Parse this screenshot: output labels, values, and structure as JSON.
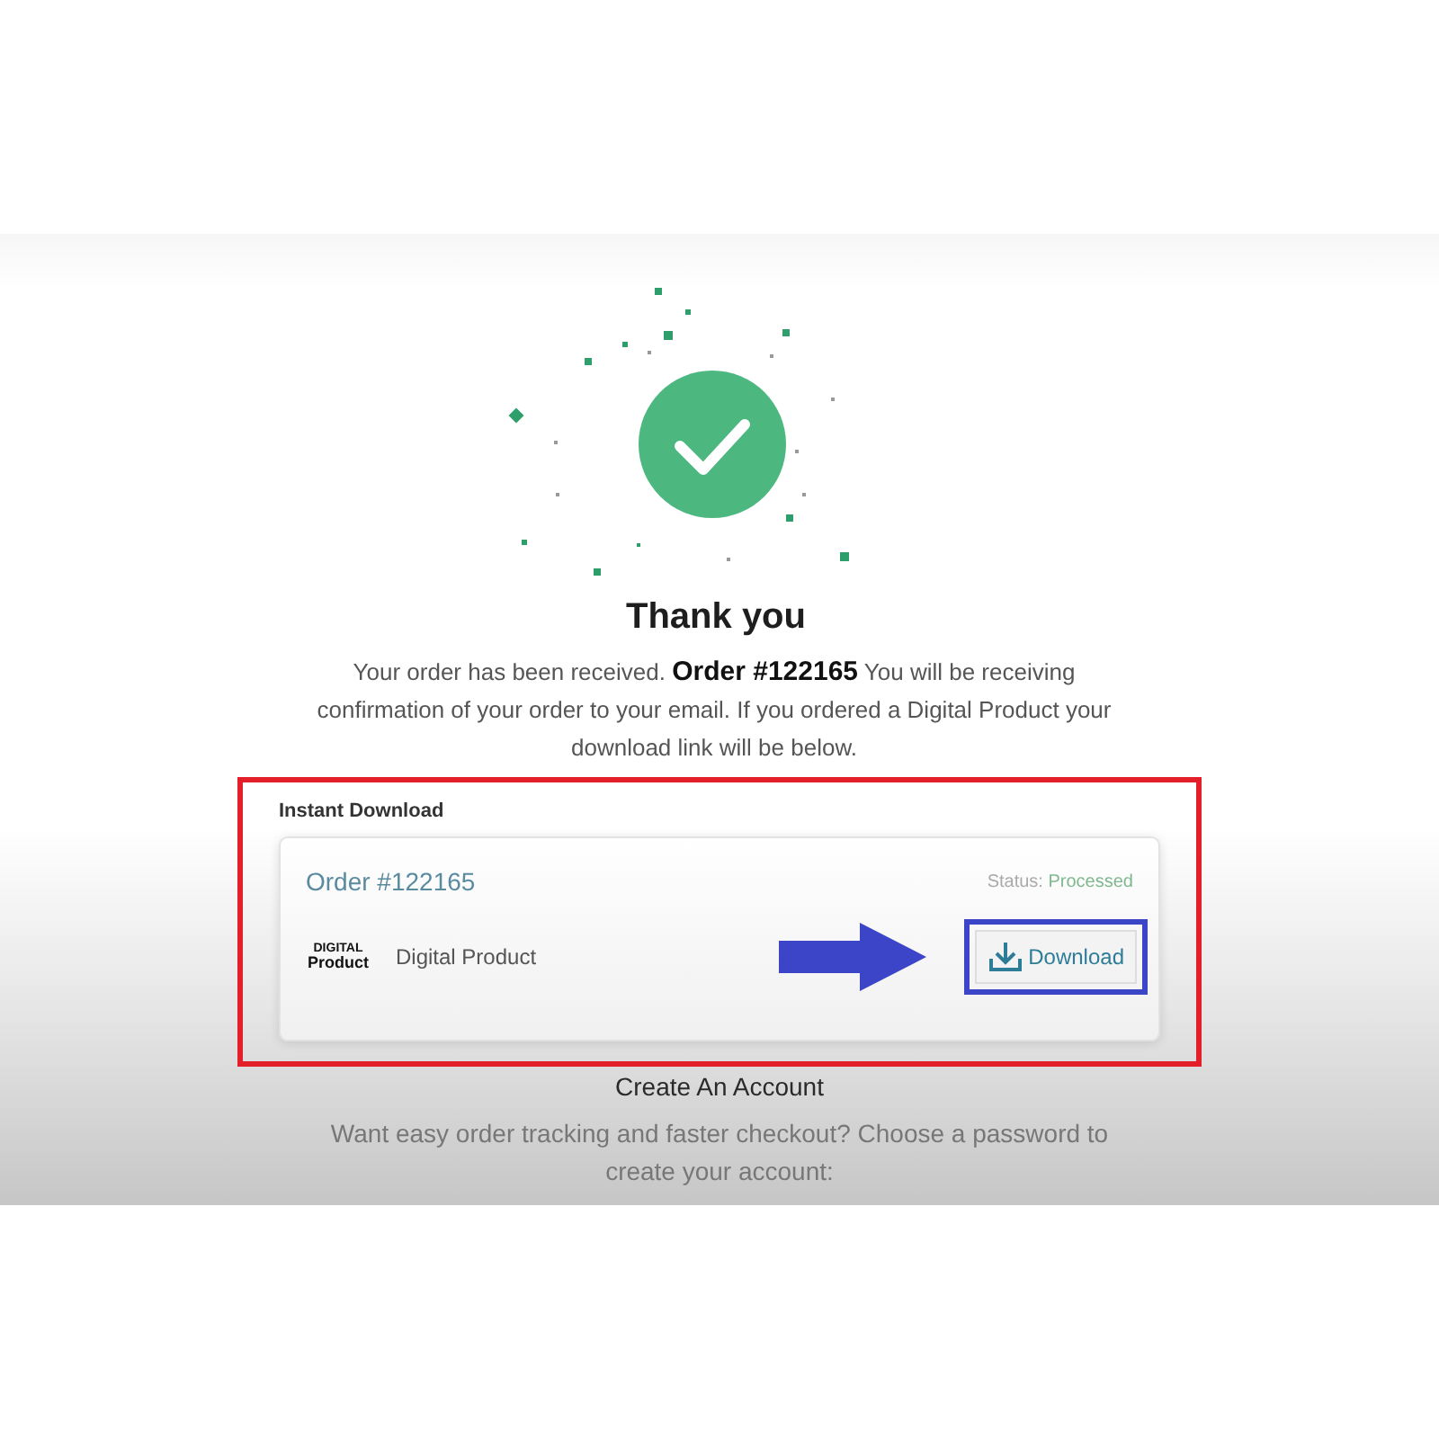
{
  "confirmation": {
    "title": "Thank you",
    "message": "Your order has been received. **Order #122165** You will be receiving confirmation of your order to your email. If you ordered a Digital Product your download link will be below."
  },
  "instant_download": {
    "heading": "Instant Download",
    "highlighted": true,
    "order": {
      "number": "Order #122165",
      "status_label": "Status:",
      "status": "Processed",
      "items": [
        {
          "logo_lines": [
            "DIGITAL",
            "Product"
          ],
          "name": "Digital Product",
          "download": {
            "label": "Download",
            "highlighted": true,
            "arrow": true
          }
        }
      ]
    }
  },
  "create_account": {
    "title": "Create An Account",
    "message": "Want easy order tracking and faster checkout? Choose a password to create your account:"
  }
}
